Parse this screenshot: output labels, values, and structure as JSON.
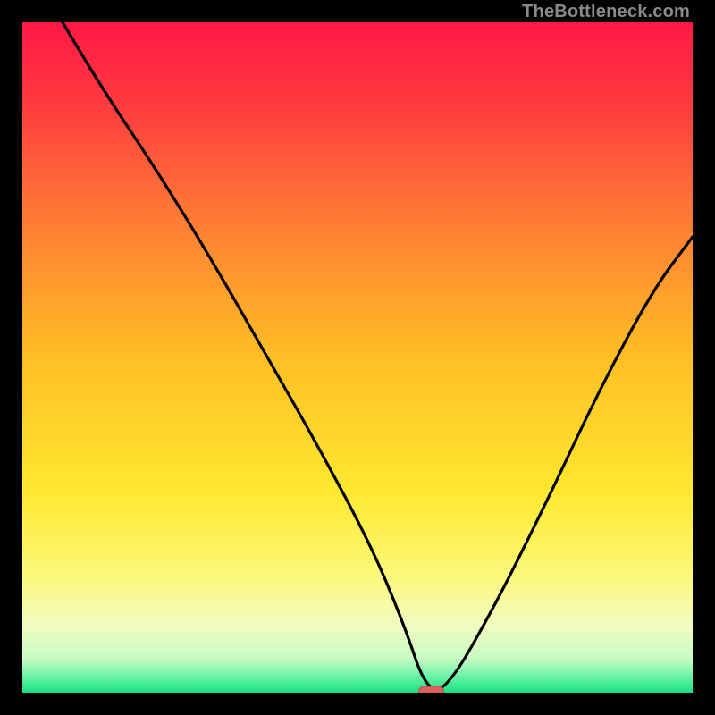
{
  "watermark": "TheBottleneck.com",
  "colors": {
    "frame": "#000000",
    "curve": "#000000",
    "marker_fill": "#d9625f",
    "marker_stroke": "#b74a47",
    "gradient_stops": [
      {
        "offset": 0.0,
        "color": "#ff1846"
      },
      {
        "offset": 0.12,
        "color": "#ff3a3f"
      },
      {
        "offset": 0.3,
        "color": "#ff7e34"
      },
      {
        "offset": 0.5,
        "color": "#ffbf25"
      },
      {
        "offset": 0.7,
        "color": "#ffe82f"
      },
      {
        "offset": 0.82,
        "color": "#fcf877"
      },
      {
        "offset": 0.9,
        "color": "#f2fcc0"
      },
      {
        "offset": 0.95,
        "color": "#c7fbc3"
      },
      {
        "offset": 0.975,
        "color": "#6cf3a8"
      },
      {
        "offset": 1.0,
        "color": "#18e082"
      }
    ]
  },
  "chart_data": {
    "type": "line",
    "title": "",
    "xlabel": "",
    "ylabel": "",
    "xlim": [
      0,
      100
    ],
    "ylim": [
      0,
      100
    ],
    "marker": {
      "x": 61,
      "y": 0
    },
    "series": [
      {
        "name": "bottleneck-curve",
        "x": [
          6,
          12,
          20,
          28,
          36,
          44,
          52,
          57,
          60,
          63,
          70,
          78,
          86,
          94,
          100
        ],
        "y": [
          100,
          90,
          78,
          65,
          51,
          37,
          22,
          10,
          1,
          0,
          12,
          28,
          45,
          60,
          68
        ]
      }
    ]
  }
}
